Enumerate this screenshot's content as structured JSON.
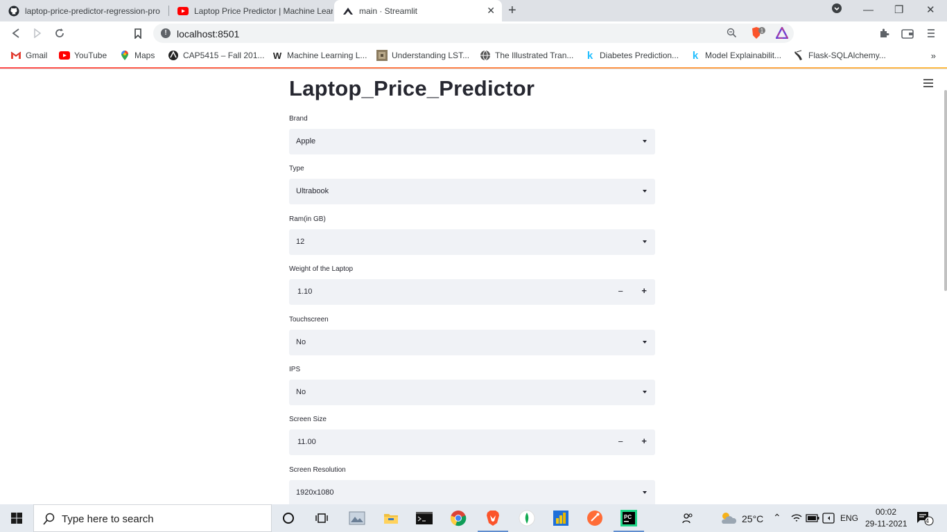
{
  "browser": {
    "tabs": [
      {
        "title": "laptop-price-predictor-regression-pro",
        "favicon": "github-icon",
        "active": false
      },
      {
        "title": "Laptop Price Predictor | Machine Learn",
        "favicon": "youtube-icon",
        "active": false
      },
      {
        "title": "main · Streamlit",
        "favicon": "streamlit-icon",
        "active": true
      }
    ],
    "new_tab": "+",
    "url": "localhost:8501",
    "brave_badge": "1"
  },
  "bookmarks": [
    {
      "label": "Gmail",
      "icon": "gmail-icon"
    },
    {
      "label": "YouTube",
      "icon": "youtube-icon"
    },
    {
      "label": "Maps",
      "icon": "maps-icon"
    },
    {
      "label": "CAP5415 – Fall 201...",
      "icon": "ucf-icon"
    },
    {
      "label": "Machine Learning L...",
      "icon": "w-icon"
    },
    {
      "label": "Understanding LST...",
      "icon": "image-icon"
    },
    {
      "label": "The Illustrated Tran...",
      "icon": "globe-icon"
    },
    {
      "label": "Diabetes Prediction...",
      "icon": "kaggle-icon"
    },
    {
      "label": "Model Explainabilit...",
      "icon": "kaggle-icon"
    },
    {
      "label": "Flask-SQLAlchemy...",
      "icon": "flask-icon"
    }
  ],
  "app": {
    "title": "Laptop_Price_Predictor",
    "fields": [
      {
        "label": "Brand",
        "value": "Apple",
        "kind": "select"
      },
      {
        "label": "Type",
        "value": "Ultrabook",
        "kind": "select"
      },
      {
        "label": "Ram(in GB)",
        "value": "12",
        "kind": "select"
      },
      {
        "label": "Weight of the Laptop",
        "value": "1.10",
        "kind": "number"
      },
      {
        "label": "Touchscreen",
        "value": "No",
        "kind": "select"
      },
      {
        "label": "IPS",
        "value": "No",
        "kind": "select"
      },
      {
        "label": "Screen Size",
        "value": "11.00",
        "kind": "number"
      },
      {
        "label": "Screen Resolution",
        "value": "1920x1080",
        "kind": "select"
      }
    ],
    "stepper_minus": "−",
    "stepper_plus": "+"
  },
  "taskbar": {
    "search_placeholder": "Type here to search",
    "temperature": "25°C",
    "language": "ENG",
    "time": "00:02",
    "date": "29-11-2021",
    "notifications": "4"
  }
}
